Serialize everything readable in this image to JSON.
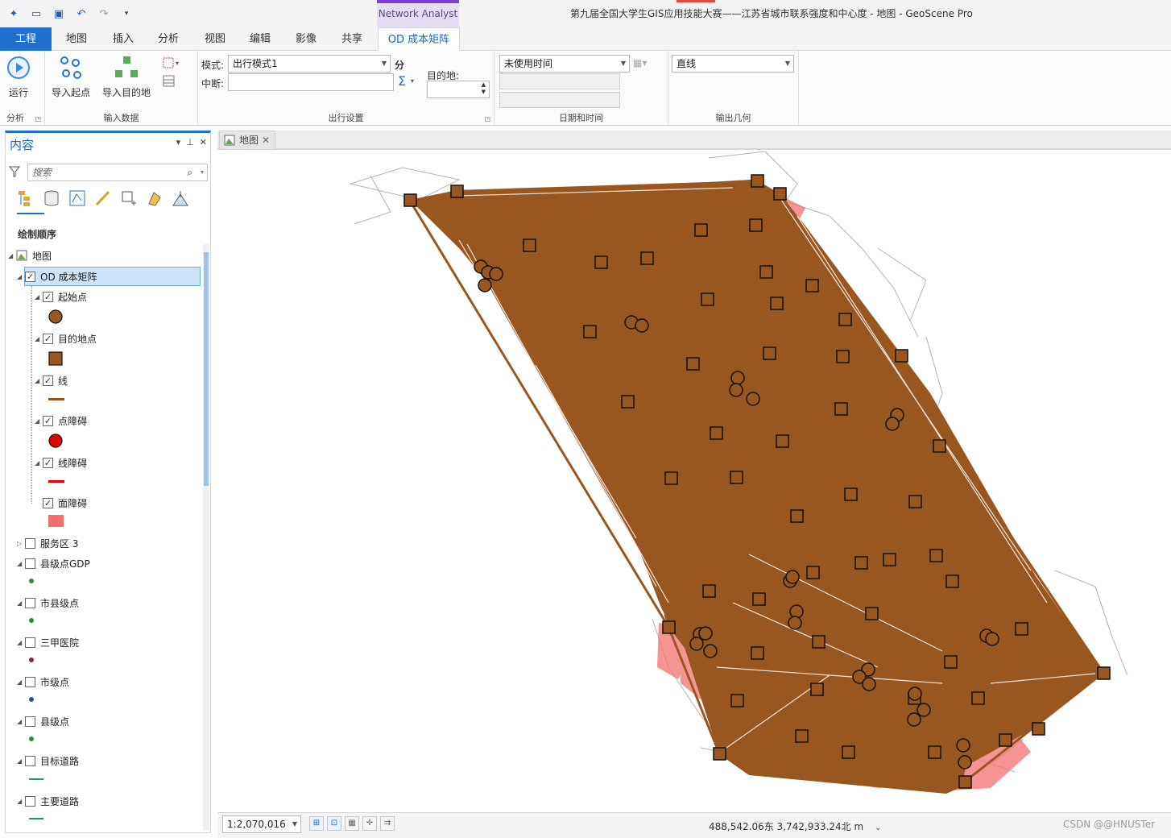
{
  "window": {
    "title": "第九届全国大学生GIS应用技能大赛——江苏省城市联系强度和中心度 - 地图 - GeoScene Pro",
    "contextual_group": "Network Analyst"
  },
  "ribbon_tabs": [
    {
      "label": "工程"
    },
    {
      "label": "地图"
    },
    {
      "label": "插入"
    },
    {
      "label": "分析"
    },
    {
      "label": "视图"
    },
    {
      "label": "编辑"
    },
    {
      "label": "影像"
    },
    {
      "label": "共享"
    },
    {
      "label": "OD 成本矩阵"
    }
  ],
  "ribbon": {
    "analysis": {
      "run_label": "运行",
      "group_label": "分析"
    },
    "input": {
      "import_origins": "导入起点",
      "import_destinations": "导入目的地",
      "group_label": "输入数据"
    },
    "travel": {
      "mode_label": "模式:",
      "mode_value": "出行模式1",
      "cutoff_label": "中断:",
      "cutoff_value": "",
      "unit_label": "分",
      "destinations_label": "目的地:",
      "destinations_value": "",
      "group_label": "出行设置"
    },
    "datetime": {
      "time_value": "未使用时间",
      "group_label": "日期和时间"
    },
    "output": {
      "shape_value": "直线",
      "group_label": "输出几何"
    }
  },
  "contents": {
    "title": "内容",
    "search_placeholder": "搜索",
    "drawing_order": "绘制顺序",
    "layers": [
      {
        "label": "地图",
        "checked": true
      },
      {
        "label": "OD 成本矩阵",
        "checked": true
      },
      {
        "label": "起始点",
        "checked": true
      },
      {
        "label": "目的地点",
        "checked": true
      },
      {
        "label": "线",
        "checked": true
      },
      {
        "label": "点障碍",
        "checked": true
      },
      {
        "label": "线障碍",
        "checked": true
      },
      {
        "label": "面障碍",
        "checked": true
      },
      {
        "label": "服务区 3",
        "checked": false
      },
      {
        "label": "县级点GDP",
        "checked": false
      },
      {
        "label": "市县级点",
        "checked": false
      },
      {
        "label": "三甲医院",
        "checked": false
      },
      {
        "label": "市级点",
        "checked": false
      },
      {
        "label": "县级点",
        "checked": false
      },
      {
        "label": "目标道路",
        "checked": false
      },
      {
        "label": "主要道路",
        "checked": false
      }
    ]
  },
  "colors": {
    "accent": "#1f6fcf",
    "od_lines": "#9a561f",
    "origin_point": "#9a561f",
    "destination_point": "#9a561f",
    "point_barrier": "#e00000",
    "line_barrier": "#e00000",
    "polygon_barrier": "#f36f6f",
    "roads": "#b4b4b4",
    "gdp_point": "#2e8b3e",
    "hospital_point": "#8b2a2a",
    "city_point": "#2f4f8f",
    "county_point": "#2e8b3e",
    "target_road": "#2e8b6e",
    "main_road": "#2e8b6e"
  },
  "map": {
    "tab_label": "地图"
  },
  "status": {
    "scale": "1:2,070,016",
    "coordinates": "488,542.06东 3,742,933.24北 m"
  },
  "watermark": "CSDN @@HNUSTer"
}
